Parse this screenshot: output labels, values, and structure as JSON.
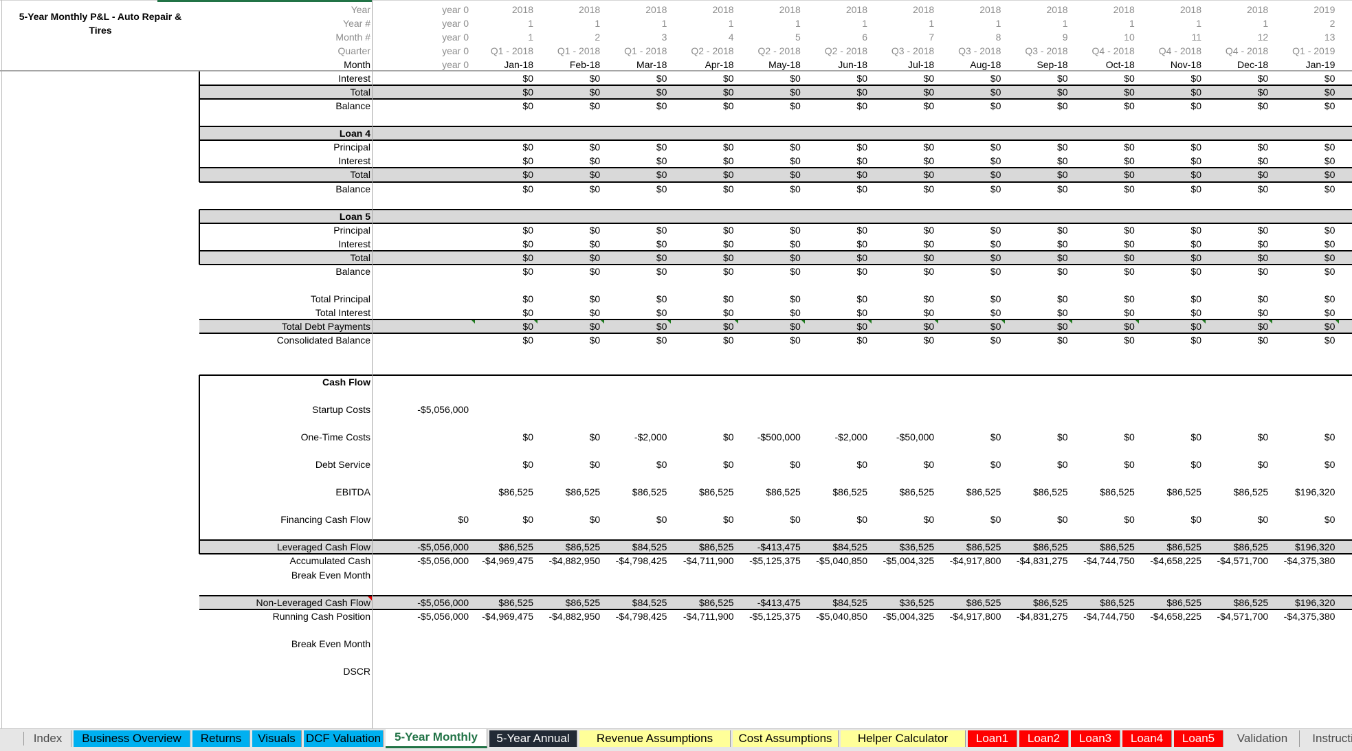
{
  "sheet_title": "5-Year Monthly P&L - Auto Repair & Tires",
  "colors": {
    "active_tab": "#217346",
    "shade_row": "#d9d9d9",
    "tab_blue": "#00b0f0",
    "tab_dark": "#222a35",
    "tab_yellow": "#ffff99",
    "tab_red": "#ff0000",
    "tab_grey": "#e6e6e6",
    "comment_green": "#1f7a1f",
    "comment_red": "#e00000"
  },
  "header_rows": [
    {
      "label": "Year",
      "y0": "year 0",
      "values": [
        "2018",
        "2018",
        "2018",
        "2018",
        "2018",
        "2018",
        "2018",
        "2018",
        "2018",
        "2018",
        "2018",
        "2018",
        "2019"
      ]
    },
    {
      "label": "Year #",
      "y0": "year 0",
      "values": [
        "1",
        "1",
        "1",
        "1",
        "1",
        "1",
        "1",
        "1",
        "1",
        "1",
        "1",
        "1",
        "2"
      ]
    },
    {
      "label": "Month #",
      "y0": "year 0",
      "values": [
        "1",
        "2",
        "3",
        "4",
        "5",
        "6",
        "7",
        "8",
        "9",
        "10",
        "11",
        "12",
        "13"
      ]
    },
    {
      "label": "Quarter",
      "y0": "year 0",
      "values": [
        "Q1 - 2018",
        "Q1 - 2018",
        "Q1 - 2018",
        "Q2 - 2018",
        "Q2 - 2018",
        "Q2 - 2018",
        "Q3 - 2018",
        "Q3 - 2018",
        "Q3 - 2018",
        "Q4 - 2018",
        "Q4 - 2018",
        "Q4 - 2018",
        "Q1 - 2019"
      ]
    },
    {
      "label": "Month",
      "y0": "year 0",
      "values": [
        "Jan-18",
        "Feb-18",
        "Mar-18",
        "Apr-18",
        "May-18",
        "Jun-18",
        "Jul-18",
        "Aug-18",
        "Sep-18",
        "Oct-18",
        "Nov-18",
        "Dec-18",
        "Jan-19"
      ]
    }
  ],
  "body_rows": [
    {
      "label": "Interest",
      "y0": "",
      "values": [
        "$0",
        "$0",
        "$0",
        "$0",
        "$0",
        "$0",
        "$0",
        "$0",
        "$0",
        "$0",
        "$0",
        "$0",
        "$0"
      ]
    },
    {
      "label": "Total",
      "y0": "",
      "values": [
        "$0",
        "$0",
        "$0",
        "$0",
        "$0",
        "$0",
        "$0",
        "$0",
        "$0",
        "$0",
        "$0",
        "$0",
        "$0"
      ]
    },
    {
      "label": "Balance",
      "y0": "",
      "values": [
        "$0",
        "$0",
        "$0",
        "$0",
        "$0",
        "$0",
        "$0",
        "$0",
        "$0",
        "$0",
        "$0",
        "$0",
        "$0"
      ]
    },
    {
      "label": "",
      "y0": "",
      "values": []
    },
    {
      "label": "Loan 4",
      "y0": "",
      "values": []
    },
    {
      "label": "Principal",
      "y0": "",
      "values": [
        "$0",
        "$0",
        "$0",
        "$0",
        "$0",
        "$0",
        "$0",
        "$0",
        "$0",
        "$0",
        "$0",
        "$0",
        "$0"
      ]
    },
    {
      "label": "Interest",
      "y0": "",
      "values": [
        "$0",
        "$0",
        "$0",
        "$0",
        "$0",
        "$0",
        "$0",
        "$0",
        "$0",
        "$0",
        "$0",
        "$0",
        "$0"
      ]
    },
    {
      "label": "Total",
      "y0": "",
      "values": [
        "$0",
        "$0",
        "$0",
        "$0",
        "$0",
        "$0",
        "$0",
        "$0",
        "$0",
        "$0",
        "$0",
        "$0",
        "$0"
      ]
    },
    {
      "label": "Balance",
      "y0": "",
      "values": [
        "$0",
        "$0",
        "$0",
        "$0",
        "$0",
        "$0",
        "$0",
        "$0",
        "$0",
        "$0",
        "$0",
        "$0",
        "$0"
      ]
    },
    {
      "label": "",
      "y0": "",
      "values": []
    },
    {
      "label": "Loan 5",
      "y0": "",
      "values": []
    },
    {
      "label": "Principal",
      "y0": "",
      "values": [
        "$0",
        "$0",
        "$0",
        "$0",
        "$0",
        "$0",
        "$0",
        "$0",
        "$0",
        "$0",
        "$0",
        "$0",
        "$0"
      ]
    },
    {
      "label": "Interest",
      "y0": "",
      "values": [
        "$0",
        "$0",
        "$0",
        "$0",
        "$0",
        "$0",
        "$0",
        "$0",
        "$0",
        "$0",
        "$0",
        "$0",
        "$0"
      ]
    },
    {
      "label": "Total",
      "y0": "",
      "values": [
        "$0",
        "$0",
        "$0",
        "$0",
        "$0",
        "$0",
        "$0",
        "$0",
        "$0",
        "$0",
        "$0",
        "$0",
        "$0"
      ]
    },
    {
      "label": "Balance",
      "y0": "",
      "values": [
        "$0",
        "$0",
        "$0",
        "$0",
        "$0",
        "$0",
        "$0",
        "$0",
        "$0",
        "$0",
        "$0",
        "$0",
        "$0"
      ]
    },
    {
      "label": "",
      "y0": "",
      "values": []
    },
    {
      "label": "Total Principal",
      "y0": "",
      "values": [
        "$0",
        "$0",
        "$0",
        "$0",
        "$0",
        "$0",
        "$0",
        "$0",
        "$0",
        "$0",
        "$0",
        "$0",
        "$0"
      ]
    },
    {
      "label": "Total Interest",
      "y0": "",
      "values": [
        "$0",
        "$0",
        "$0",
        "$0",
        "$0",
        "$0",
        "$0",
        "$0",
        "$0",
        "$0",
        "$0",
        "$0",
        "$0"
      ]
    },
    {
      "label": "Total Debt Payments",
      "y0": "",
      "values": [
        "$0",
        "$0",
        "$0",
        "$0",
        "$0",
        "$0",
        "$0",
        "$0",
        "$0",
        "$0",
        "$0",
        "$0",
        "$0"
      ]
    },
    {
      "label": "Consolidated Balance",
      "y0": "",
      "values": [
        "$0",
        "$0",
        "$0",
        "$0",
        "$0",
        "$0",
        "$0",
        "$0",
        "$0",
        "$0",
        "$0",
        "$0",
        "$0"
      ]
    },
    {
      "label": "",
      "y0": "",
      "values": []
    },
    {
      "label": "",
      "y0": "",
      "values": []
    },
    {
      "label": "Cash Flow",
      "y0": "",
      "values": []
    },
    {
      "label": "",
      "y0": "",
      "values": []
    },
    {
      "label": "Startup Costs",
      "y0": "-$5,056,000",
      "values": []
    },
    {
      "label": "",
      "y0": "",
      "values": []
    },
    {
      "label": "One-Time Costs",
      "y0": "",
      "values": [
        "$0",
        "$0",
        "-$2,000",
        "$0",
        "-$500,000",
        "-$2,000",
        "-$50,000",
        "$0",
        "$0",
        "$0",
        "$0",
        "$0",
        "$0"
      ]
    },
    {
      "label": "",
      "y0": "",
      "values": []
    },
    {
      "label": "Debt Service",
      "y0": "",
      "values": [
        "$0",
        "$0",
        "$0",
        "$0",
        "$0",
        "$0",
        "$0",
        "$0",
        "$0",
        "$0",
        "$0",
        "$0",
        "$0"
      ]
    },
    {
      "label": "",
      "y0": "",
      "values": []
    },
    {
      "label": "EBITDA",
      "y0": "",
      "values": [
        "$86,525",
        "$86,525",
        "$86,525",
        "$86,525",
        "$86,525",
        "$86,525",
        "$86,525",
        "$86,525",
        "$86,525",
        "$86,525",
        "$86,525",
        "$86,525",
        "$196,320"
      ]
    },
    {
      "label": "",
      "y0": "",
      "values": []
    },
    {
      "label": "Financing Cash Flow",
      "y0": "$0",
      "values": [
        "$0",
        "$0",
        "$0",
        "$0",
        "$0",
        "$0",
        "$0",
        "$0",
        "$0",
        "$0",
        "$0",
        "$0",
        "$0"
      ]
    },
    {
      "label": "",
      "y0": "",
      "values": []
    },
    {
      "label": "Leveraged Cash Flow",
      "y0": "-$5,056,000",
      "values": [
        "$86,525",
        "$86,525",
        "$84,525",
        "$86,525",
        "-$413,475",
        "$84,525",
        "$36,525",
        "$86,525",
        "$86,525",
        "$86,525",
        "$86,525",
        "$86,525",
        "$196,320"
      ]
    },
    {
      "label": "Accumulated Cash",
      "y0": "-$5,056,000",
      "values": [
        "-$4,969,475",
        "-$4,882,950",
        "-$4,798,425",
        "-$4,711,900",
        "-$5,125,375",
        "-$5,040,850",
        "-$5,004,325",
        "-$4,917,800",
        "-$4,831,275",
        "-$4,744,750",
        "-$4,658,225",
        "-$4,571,700",
        "-$4,375,380"
      ]
    },
    {
      "label": "Break Even Month",
      "y0": "",
      "values": []
    },
    {
      "label": "",
      "y0": "",
      "values": []
    },
    {
      "label": "Non-Leveraged Cash Flow",
      "y0": "-$5,056,000",
      "values": [
        "$86,525",
        "$86,525",
        "$84,525",
        "$86,525",
        "-$413,475",
        "$84,525",
        "$36,525",
        "$86,525",
        "$86,525",
        "$86,525",
        "$86,525",
        "$86,525",
        "$196,320"
      ]
    },
    {
      "label": "Running Cash Position",
      "y0": "-$5,056,000",
      "values": [
        "-$4,969,475",
        "-$4,882,950",
        "-$4,798,425",
        "-$4,711,900",
        "-$5,125,375",
        "-$5,040,850",
        "-$5,004,325",
        "-$4,917,800",
        "-$4,831,275",
        "-$4,744,750",
        "-$4,658,225",
        "-$4,571,700",
        "-$4,375,380"
      ]
    },
    {
      "label": "",
      "y0": "",
      "values": []
    },
    {
      "label": "Break Even Month",
      "y0": "",
      "values": []
    },
    {
      "label": "",
      "y0": "",
      "values": []
    },
    {
      "label": "DSCR",
      "y0": "",
      "values": []
    }
  ],
  "tabs": [
    {
      "label": "Index",
      "style": "grey"
    },
    {
      "label": "Business Overview",
      "style": "blue"
    },
    {
      "label": "Returns",
      "style": "blue"
    },
    {
      "label": "Visuals",
      "style": "blue"
    },
    {
      "label": "DCF Valuation",
      "style": "blue"
    },
    {
      "label": "5-Year Monthly",
      "style": "active"
    },
    {
      "label": "5-Year Annual",
      "style": "dark"
    },
    {
      "label": "Revenue Assumptions",
      "style": "yellow"
    },
    {
      "label": "Cost Assumptions",
      "style": "yellow"
    },
    {
      "label": "Helper Calculator",
      "style": "yellow"
    },
    {
      "label": "Loan1",
      "style": "red"
    },
    {
      "label": "Loan2",
      "style": "red"
    },
    {
      "label": "Loan3",
      "style": "red"
    },
    {
      "label": "Loan4",
      "style": "red"
    },
    {
      "label": "Loan5",
      "style": "red"
    },
    {
      "label": "Validation",
      "style": "grey"
    },
    {
      "label": "Instruction",
      "style": "grey"
    }
  ]
}
